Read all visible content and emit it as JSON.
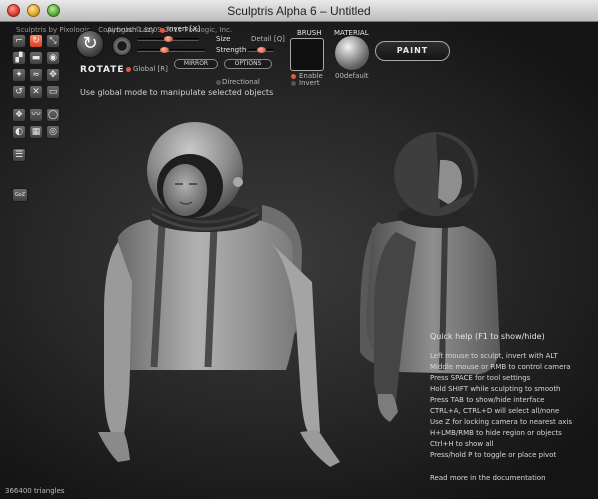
{
  "window": {
    "title": "Sculptris Alpha 6 – Untitled"
  },
  "topbar": {
    "app_name": "Sculptris by Pixologic",
    "copyright": "Copyright © 2009-2011 Pixologic, Inc."
  },
  "tools": [
    {
      "icon": "crease-tool-icon",
      "glyph": "⌐",
      "active": false
    },
    {
      "icon": "rotate-tool-icon",
      "glyph": "↻",
      "active": true
    },
    {
      "icon": "scale-tool-icon",
      "glyph": "⤡",
      "active": false
    },
    {
      "icon": "draw-tool-icon",
      "glyph": "▞",
      "active": false
    },
    {
      "icon": "flatten-tool-icon",
      "glyph": "▬",
      "active": false
    },
    {
      "icon": "inflate-tool-icon",
      "glyph": "◉",
      "active": false
    },
    {
      "icon": "pinch-tool-icon",
      "glyph": "✦",
      "active": false
    },
    {
      "icon": "smooth-tool-icon",
      "glyph": "≈",
      "active": false
    },
    {
      "icon": "grab-tool-icon",
      "glyph": "✥",
      "active": false
    },
    {
      "icon": "reduce-tool-icon",
      "glyph": "↺",
      "active": false
    },
    {
      "icon": "mask-tool-icon",
      "glyph": "✕",
      "active": false
    },
    {
      "icon": "symmetry-tool-icon",
      "glyph": "▭",
      "active": false
    },
    {
      "icon": "layers-tool-icon",
      "glyph": "❖",
      "active": false
    },
    {
      "icon": "wave-tool-icon",
      "glyph": "〰",
      "active": false
    },
    {
      "icon": "sphere-tool-icon",
      "glyph": "◯",
      "active": false
    },
    {
      "icon": "open-file-icon",
      "glyph": "◐",
      "active": false
    },
    {
      "icon": "save-file-icon",
      "glyph": "▦",
      "active": false
    },
    {
      "icon": "wireframe-icon",
      "glyph": "◎",
      "active": false
    },
    {
      "icon": "settings-icon",
      "glyph": "☰",
      "active": false
    },
    {
      "icon": "goz-icon",
      "glyph": "GoZ",
      "active": false
    }
  ],
  "brush_controls": {
    "airbrush_label": "Airbrush",
    "lazy_label": "Lazy",
    "invert_label": "Invert [X]",
    "size_label": "Size",
    "detail_label": "Detail [Q]",
    "strength_label": "Strength",
    "rotate_label": "ROTATE",
    "global_label": "Global [R]",
    "mirror_label": "MIRROR",
    "options_label": "OPTIONS",
    "directional_label": "Directional",
    "size_value": 0.5,
    "strength_value": 0.4,
    "detail_value": 0.5
  },
  "hint_text": "Use global mode to manipulate selected objects",
  "brush": {
    "heading": "BRUSH",
    "enable_label": "Enable",
    "invert_label": "Invert"
  },
  "material": {
    "heading": "MATERIAL",
    "name": "00default"
  },
  "paint_button_label": "PAINT",
  "quick_help": {
    "title": "Quick help (F1 to show/hide)",
    "lines": [
      "Left mouse to sculpt, invert with ALT",
      "Middle mouse or RMB to control camera",
      "Press SPACE for tool settings",
      "Hold SHIFT while sculpting to smooth",
      "Press TAB to show/hide interface",
      "CTRL+A, CTRL+D will select all/none",
      "Use Z for locking camera to nearest axis",
      "H+LMB/RMB to hide region or objects",
      "Ctrl+H to show all",
      "Press/hold P to toggle or place pivot"
    ],
    "documentation_link": "Read more in the documentation"
  },
  "status": {
    "triangle_count": "366400 triangles"
  }
}
